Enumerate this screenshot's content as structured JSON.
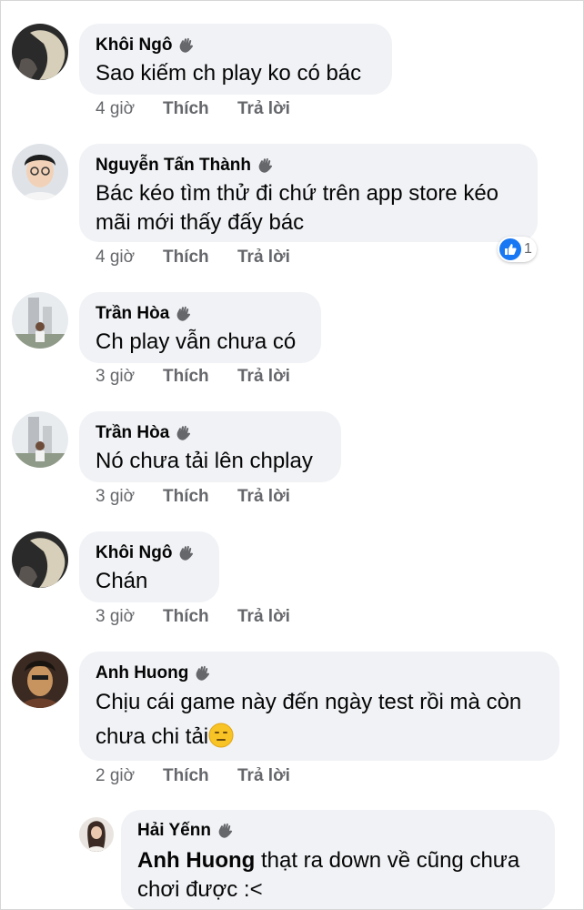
{
  "colors": {
    "bubble": "#f0f2f5",
    "action_text": "#65676b",
    "like_blue": "#1877f2"
  },
  "actions": {
    "like_label": "Thích",
    "reply_label": "Trả lời"
  },
  "comments": [
    {
      "author": "Khôi Ngô",
      "badge_icon": "wave-hand-icon",
      "text": "Sao kiếm ch play ko có bác",
      "time": "4 giờ"
    },
    {
      "author": "Nguyễn Tấn Thành",
      "badge_icon": "wave-hand-icon",
      "text_line1": "Bác kéo tìm thử đi chứ trên app store kéo",
      "text_line2": "mãi mới thấy đấy bác",
      "time": "4 giờ",
      "reaction_count": "1"
    },
    {
      "author": "Trần Hòa",
      "badge_icon": "wave-hand-icon",
      "text": "Ch play vẫn chưa có",
      "time": "3 giờ"
    },
    {
      "author": "Trần Hòa",
      "badge_icon": "wave-hand-icon",
      "text": "Nó chưa tải lên chplay",
      "time": "3 giờ"
    },
    {
      "author": "Khôi Ngô",
      "badge_icon": "wave-hand-icon",
      "text": "Chán",
      "time": "3 giờ"
    },
    {
      "author": "Anh Huong",
      "badge_icon": "wave-hand-icon",
      "text_line1": "Chịu cái game này đến ngày test rồi mà còn",
      "text_line2": "chưa chi tải",
      "emoji": "expressionless-face-emoji",
      "time": "2 giờ"
    }
  ],
  "reply": {
    "author": "Hải Yếnn",
    "badge_icon": "wave-hand-icon",
    "mention": "Anh Huong",
    "text_line1": " thạt ra down về cũng chưa",
    "text_line2": "chơi được :<"
  }
}
